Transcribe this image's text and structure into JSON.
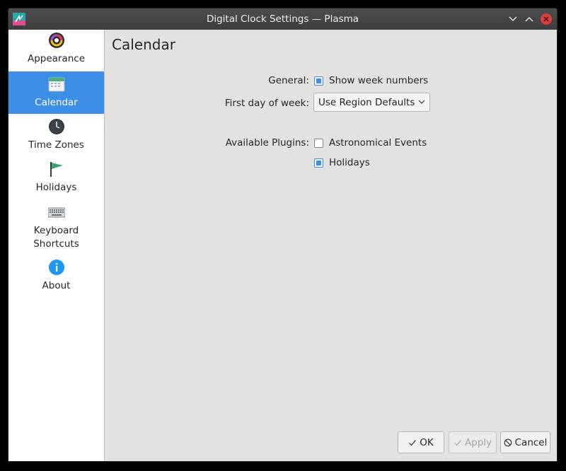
{
  "window": {
    "title": "Digital Clock Settings — Plasma"
  },
  "sidebar": {
    "items": [
      {
        "label": "Appearance",
        "icon": "appearance-icon"
      },
      {
        "label": "Calendar",
        "icon": "calendar-icon",
        "selected": true
      },
      {
        "label": "Time Zones",
        "icon": "clock-icon"
      },
      {
        "label": "Holidays",
        "icon": "flag-icon"
      },
      {
        "label": "Keyboard Shortcuts",
        "icon": "keyboard-icon"
      },
      {
        "label": "About",
        "icon": "info-icon"
      }
    ]
  },
  "page": {
    "title": "Calendar",
    "general_label": "General:",
    "show_week_numbers": {
      "label": "Show week numbers",
      "checked": true
    },
    "first_day_label": "First day of week:",
    "first_day_value": "Use Region Defaults",
    "plugins_label": "Available Plugins:",
    "plugins": [
      {
        "label": "Astronomical Events",
        "checked": false
      },
      {
        "label": "Holidays",
        "checked": true
      }
    ]
  },
  "buttons": {
    "ok": "OK",
    "apply": "Apply",
    "cancel": "Cancel"
  },
  "colors": {
    "accent": "#3d8ee6",
    "close": "#da3f3f",
    "titlebar": "#444444"
  }
}
